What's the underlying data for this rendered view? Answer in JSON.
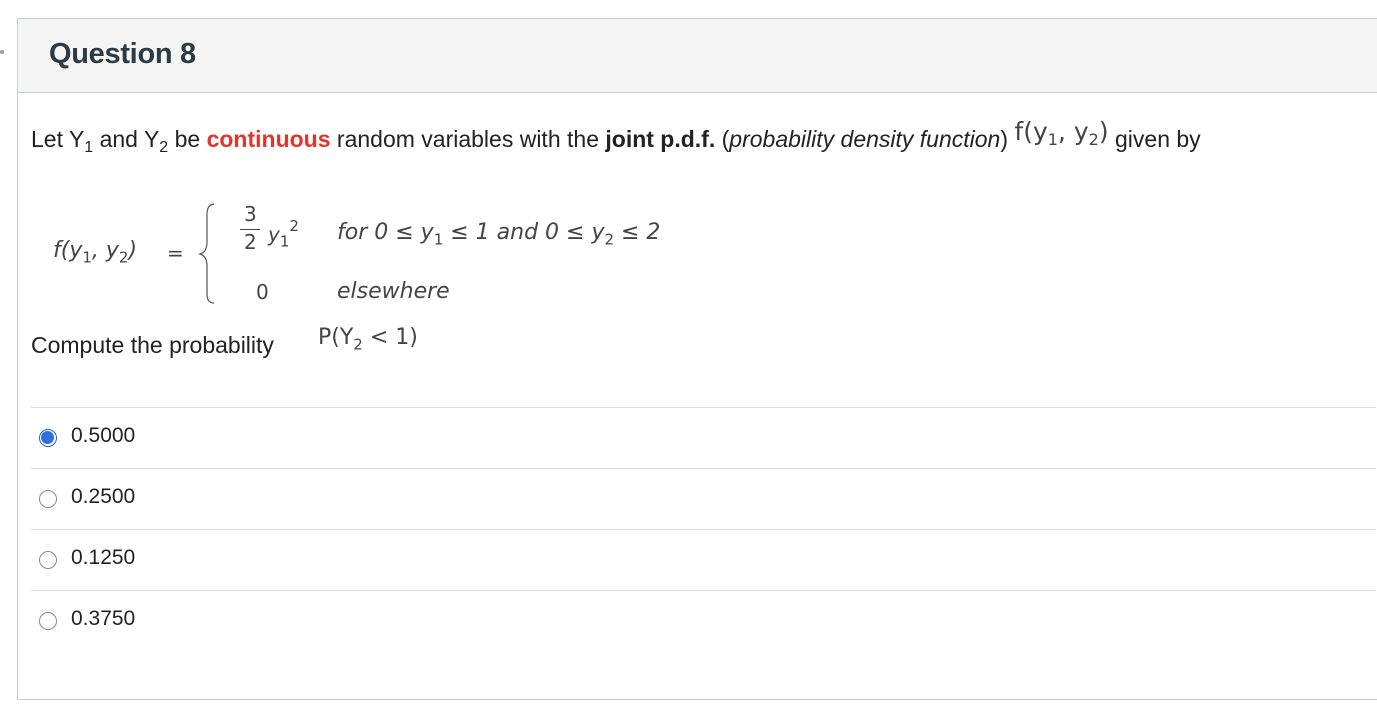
{
  "question": {
    "title": "Question 8",
    "stem": {
      "let": "Let Y",
      "sub1": "1",
      "and": " and  Y",
      "sub2": "2",
      "be": " be ",
      "continuous": "continuous",
      "random": " random variables with the ",
      "joint": "joint p.d.f.",
      "open_paren": " (",
      "pdf_italic": "probability density function",
      "close_paren": ")",
      "inline_f": "f(y",
      "inline_sub1": "1",
      "inline_comma": ", y",
      "inline_sub2": "2",
      "inline_close": ")",
      "given_by": " given by"
    },
    "formula": {
      "lhs_f": "f(y",
      "lhs_sub1": "1",
      "lhs_comma": ", y",
      "lhs_sub2": "2",
      "lhs_close": ")",
      "equals": "=",
      "frac_num": "3",
      "frac_den": "2",
      "var": "y",
      "var_sub": "1",
      "var_exp": "2",
      "case1_cond": "for 0 ≤ y",
      "case1_sub1": "1",
      "case1_mid": " ≤ 1 and 0 ≤ y",
      "case1_sub2": "2",
      "case1_end": " ≤ 2",
      "case2_value": "0",
      "case2_cond": "elsewhere"
    },
    "compute_text": "Compute the probability",
    "prob_expr": {
      "open": "P(Y",
      "sub": "2",
      "rest": "< 1)"
    },
    "answers": [
      {
        "label": "0.5000",
        "selected": true
      },
      {
        "label": "0.2500",
        "selected": false
      },
      {
        "label": "0.1250",
        "selected": false
      },
      {
        "label": "0.3750",
        "selected": false
      }
    ]
  },
  "colors": {
    "highlight": "#e3352b",
    "selected_radio": "#2f6fe0",
    "header_bg": "#f5f5f5"
  }
}
